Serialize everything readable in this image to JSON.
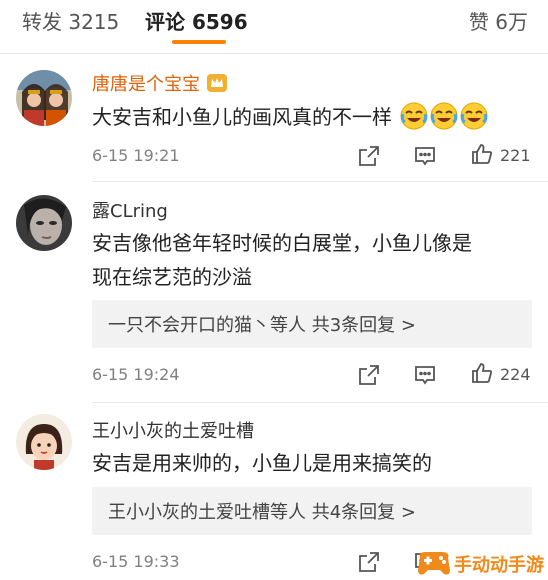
{
  "tabs": {
    "repost": "转发 3215",
    "comment": "评论 6596",
    "like": "赞 6万"
  },
  "colors": {
    "accent": "#ff8200",
    "gold_username": "#e0620a",
    "reply_background": "#f2f2f2"
  },
  "comments": [
    {
      "username": "唐唐是个宝宝",
      "badge_icon": "crown-badge-icon",
      "text": "大安吉和小鱼儿的画风真的不一样",
      "emoji_icon": "laugh-cry-emoji",
      "emoji_count": 3,
      "time": "6-15 19:21",
      "likes": "221"
    },
    {
      "username": "露CLring",
      "text_line1": "安吉像他爸年轻时候的白展堂，小鱼儿像是",
      "text_line2": "现在综艺范的沙溢",
      "reply_summary": "一只不会开口的猫丶等人  共3条回复 >",
      "time": "6-15 19:24",
      "likes": "224"
    },
    {
      "username": "王小小灰的土爱吐槽",
      "text": "安吉是用来帅的，小鱼儿是用来搞笑的",
      "reply_summary": "王小小灰的土爱吐槽等人  共4条回复 >",
      "time": "6-15 19:33"
    }
  ],
  "watermark": {
    "text": "手动动手游"
  }
}
